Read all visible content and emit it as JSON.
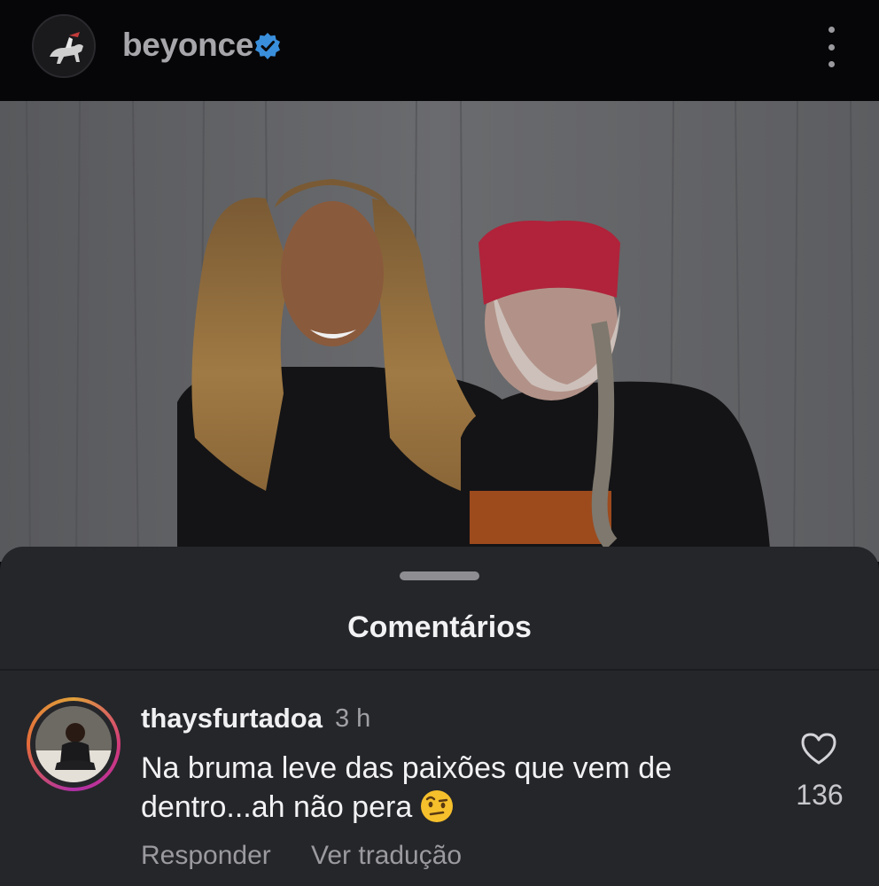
{
  "header": {
    "username": "beyonce",
    "verified": true,
    "menu_icon": "more-vertical-icon"
  },
  "colors": {
    "verified_badge": "#3a8fdc",
    "sheet_background": "#25262a",
    "header_background": "#060608"
  },
  "comments_sheet": {
    "title": "Comentários",
    "comments": [
      {
        "username": "thaysfurtadoa",
        "time": "3 h",
        "text": "Na bruma leve das paixões que vem de dentro...ah não pera",
        "emoji": "raised-eyebrow-emoji",
        "like_count": "136",
        "reply_label": "Responder",
        "translate_label": "Ver tradução"
      }
    ]
  }
}
